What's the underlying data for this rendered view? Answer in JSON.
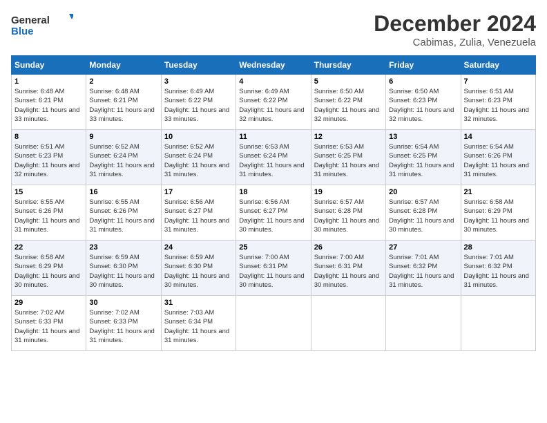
{
  "logo": {
    "line1": "General",
    "line2": "Blue"
  },
  "title": "December 2024",
  "location": "Cabimas, Zulia, Venezuela",
  "days_header": [
    "Sunday",
    "Monday",
    "Tuesday",
    "Wednesday",
    "Thursday",
    "Friday",
    "Saturday"
  ],
  "weeks": [
    [
      {
        "day": "1",
        "sunrise": "6:48 AM",
        "sunset": "6:21 PM",
        "daylight": "11 hours and 33 minutes."
      },
      {
        "day": "2",
        "sunrise": "6:48 AM",
        "sunset": "6:21 PM",
        "daylight": "11 hours and 33 minutes."
      },
      {
        "day": "3",
        "sunrise": "6:49 AM",
        "sunset": "6:22 PM",
        "daylight": "11 hours and 33 minutes."
      },
      {
        "day": "4",
        "sunrise": "6:49 AM",
        "sunset": "6:22 PM",
        "daylight": "11 hours and 32 minutes."
      },
      {
        "day": "5",
        "sunrise": "6:50 AM",
        "sunset": "6:22 PM",
        "daylight": "11 hours and 32 minutes."
      },
      {
        "day": "6",
        "sunrise": "6:50 AM",
        "sunset": "6:23 PM",
        "daylight": "11 hours and 32 minutes."
      },
      {
        "day": "7",
        "sunrise": "6:51 AM",
        "sunset": "6:23 PM",
        "daylight": "11 hours and 32 minutes."
      }
    ],
    [
      {
        "day": "8",
        "sunrise": "6:51 AM",
        "sunset": "6:23 PM",
        "daylight": "11 hours and 32 minutes."
      },
      {
        "day": "9",
        "sunrise": "6:52 AM",
        "sunset": "6:24 PM",
        "daylight": "11 hours and 31 minutes."
      },
      {
        "day": "10",
        "sunrise": "6:52 AM",
        "sunset": "6:24 PM",
        "daylight": "11 hours and 31 minutes."
      },
      {
        "day": "11",
        "sunrise": "6:53 AM",
        "sunset": "6:24 PM",
        "daylight": "11 hours and 31 minutes."
      },
      {
        "day": "12",
        "sunrise": "6:53 AM",
        "sunset": "6:25 PM",
        "daylight": "11 hours and 31 minutes."
      },
      {
        "day": "13",
        "sunrise": "6:54 AM",
        "sunset": "6:25 PM",
        "daylight": "11 hours and 31 minutes."
      },
      {
        "day": "14",
        "sunrise": "6:54 AM",
        "sunset": "6:26 PM",
        "daylight": "11 hours and 31 minutes."
      }
    ],
    [
      {
        "day": "15",
        "sunrise": "6:55 AM",
        "sunset": "6:26 PM",
        "daylight": "11 hours and 31 minutes."
      },
      {
        "day": "16",
        "sunrise": "6:55 AM",
        "sunset": "6:26 PM",
        "daylight": "11 hours and 31 minutes."
      },
      {
        "day": "17",
        "sunrise": "6:56 AM",
        "sunset": "6:27 PM",
        "daylight": "11 hours and 31 minutes."
      },
      {
        "day": "18",
        "sunrise": "6:56 AM",
        "sunset": "6:27 PM",
        "daylight": "11 hours and 30 minutes."
      },
      {
        "day": "19",
        "sunrise": "6:57 AM",
        "sunset": "6:28 PM",
        "daylight": "11 hours and 30 minutes."
      },
      {
        "day": "20",
        "sunrise": "6:57 AM",
        "sunset": "6:28 PM",
        "daylight": "11 hours and 30 minutes."
      },
      {
        "day": "21",
        "sunrise": "6:58 AM",
        "sunset": "6:29 PM",
        "daylight": "11 hours and 30 minutes."
      }
    ],
    [
      {
        "day": "22",
        "sunrise": "6:58 AM",
        "sunset": "6:29 PM",
        "daylight": "11 hours and 30 minutes."
      },
      {
        "day": "23",
        "sunrise": "6:59 AM",
        "sunset": "6:30 PM",
        "daylight": "11 hours and 30 minutes."
      },
      {
        "day": "24",
        "sunrise": "6:59 AM",
        "sunset": "6:30 PM",
        "daylight": "11 hours and 30 minutes."
      },
      {
        "day": "25",
        "sunrise": "7:00 AM",
        "sunset": "6:31 PM",
        "daylight": "11 hours and 30 minutes."
      },
      {
        "day": "26",
        "sunrise": "7:00 AM",
        "sunset": "6:31 PM",
        "daylight": "11 hours and 30 minutes."
      },
      {
        "day": "27",
        "sunrise": "7:01 AM",
        "sunset": "6:32 PM",
        "daylight": "11 hours and 31 minutes."
      },
      {
        "day": "28",
        "sunrise": "7:01 AM",
        "sunset": "6:32 PM",
        "daylight": "11 hours and 31 minutes."
      }
    ],
    [
      {
        "day": "29",
        "sunrise": "7:02 AM",
        "sunset": "6:33 PM",
        "daylight": "11 hours and 31 minutes."
      },
      {
        "day": "30",
        "sunrise": "7:02 AM",
        "sunset": "6:33 PM",
        "daylight": "11 hours and 31 minutes."
      },
      {
        "day": "31",
        "sunrise": "7:03 AM",
        "sunset": "6:34 PM",
        "daylight": "11 hours and 31 minutes."
      },
      null,
      null,
      null,
      null
    ]
  ]
}
